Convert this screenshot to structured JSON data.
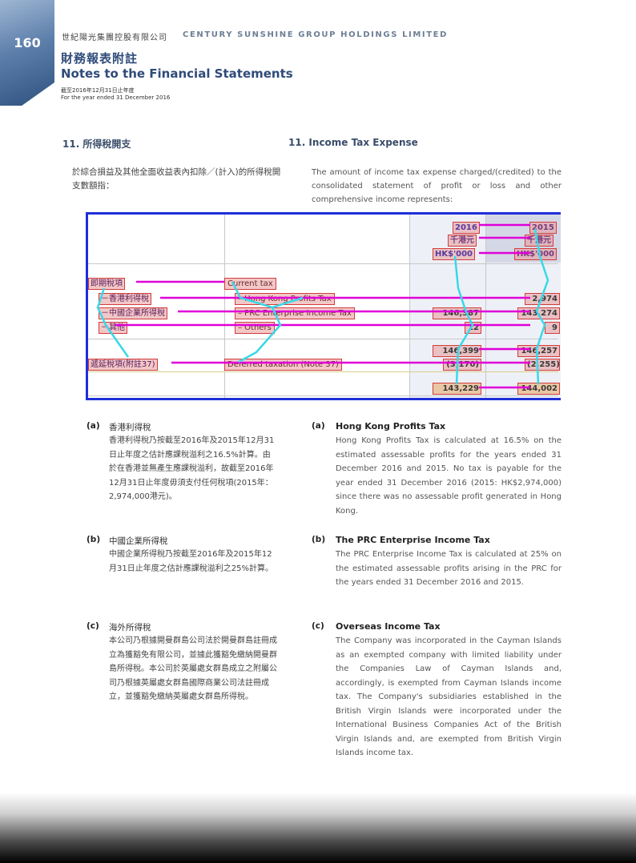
{
  "header": {
    "page_number": "160",
    "company_cn": "世紀陽光集團控股有限公司",
    "company_en": "CENTURY SUNSHINE GROUP HOLDINGS LIMITED",
    "notes_cn": "財務報表附註",
    "notes_en": "Notes to the Financial Statements",
    "period_cn": "截至2016年12月31日止年度",
    "period_en": "For the year ended 31 December 2016"
  },
  "section": {
    "title_cn": "11. 所得稅開支",
    "title_en": "11. Income Tax Expense",
    "intro_cn": "於綜合損益及其他全面收益表內扣除／(計入)的所得稅開支數額指：",
    "intro_en": "The amount of income tax expense charged/(credited) to the consolidated statement of profit or loss and other comprehensive income represents:"
  },
  "table": {
    "headers": {
      "year_2016": "2016",
      "year_2015": "2015",
      "unit_cn_2016": "千港元",
      "unit_cn_2015": "千港元",
      "unit_en_2016": "HK$'000",
      "unit_en_2015": "HK$'000"
    },
    "rows": [
      {
        "label_cn": "即期稅項",
        "label_en": "Current tax",
        "v2016": "",
        "v2015": ""
      },
      {
        "label_cn": "－香港利得稅",
        "label_en": "– Hong Kong Profits Tax",
        "v2016": "",
        "v2015": "2,974"
      },
      {
        "label_cn": "－中國企業所得稅",
        "label_en": "– PRC Enterprise Income Tax",
        "v2016": "146,387",
        "v2015": "143,274"
      },
      {
        "label_cn": "－其他",
        "label_en": "– Others",
        "v2016": "12",
        "v2015": "9"
      },
      {
        "label_cn": "",
        "label_en": "",
        "v2016": "146,399",
        "v2015": "146,257"
      },
      {
        "label_cn": "遞延稅項(附註37)",
        "label_en": "Deferred taxation (Note 37)",
        "v2016": "(3,170)",
        "v2015": "(2,255)"
      },
      {
        "label_cn": "",
        "label_en": "",
        "v2016": "143,229",
        "v2015": "144,002"
      }
    ]
  },
  "notes": [
    {
      "letter": "(a)",
      "title_cn": "香港利得稅",
      "body_cn": "香港利得稅乃按截至2016年及2015年12月31日止年度之估計應課稅溢利之16.5%計算。由於在香港並無產生應課稅溢利，故截至2016年12月31日止年度毋須支付任何稅項(2015年：2,974,000港元)。",
      "title_en": "Hong Kong Profits Tax",
      "body_en": "Hong Kong Profits Tax is calculated at 16.5% on the estimated assessable profits for the years ended 31 December 2016 and 2015. No tax is payable for the year ended 31 December 2016 (2015: HK$2,974,000) since there was no assessable profit generated in Hong Kong."
    },
    {
      "letter": "(b)",
      "title_cn": "中國企業所得稅",
      "body_cn": "中國企業所得稅乃按截至2016年及2015年12月31日止年度之估計應課稅溢利之25%計算。",
      "title_en": "The PRC Enterprise Income Tax",
      "body_en": "The PRC Enterprise Income Tax is calculated at 25% on the estimated assessable profits arising in the PRC for the years ended 31 December 2016 and 2015."
    },
    {
      "letter": "(c)",
      "title_cn": "海外所得稅",
      "body_cn": "本公司乃根據開曼群島公司法於開曼群島註冊成立為獲豁免有限公司，並據此獲豁免繳納開曼群島所得稅。本公司於英屬處女群島成立之附屬公司乃根據英屬處女群島國際商業公司法註冊成立，並獲豁免繳納英屬處女群島所得稅。",
      "title_en": "Overseas Income Tax",
      "body_en": "The Company was incorporated in the Cayman Islands as an exempted company with limited liability under the Companies Law of Cayman Islands and, accordingly, is exempted from Cayman Islands income tax. The Company's subsidiaries established in the British Virgin Islands were incorporated under the International Business Companies Act of the British Virgin Islands and, are exempted from British Virgin Islands income tax."
    }
  ],
  "colors": {
    "table_border": "#1f2fd8",
    "link_magenta": "#e000d8",
    "link_cyan": "#38d8e8",
    "box_red": "#d23c3c"
  }
}
